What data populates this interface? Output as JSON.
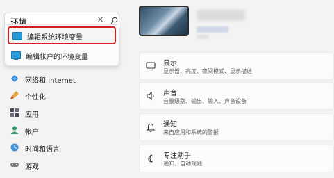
{
  "search": {
    "value": "环境",
    "clear_glyph": "×"
  },
  "results": [
    {
      "label": "编辑系统环境变量",
      "icon": "control-panel-icon"
    },
    {
      "label": "编辑帐户的环境变量",
      "icon": "control-panel-icon"
    }
  ],
  "nav": [
    {
      "label": "网络和 Internet",
      "icon": "network-icon"
    },
    {
      "label": "个性化",
      "icon": "brush-icon"
    },
    {
      "label": "应用",
      "icon": "apps-icon"
    },
    {
      "label": "帐户",
      "icon": "person-icon"
    },
    {
      "label": "时间和语言",
      "icon": "globe-clock-icon"
    },
    {
      "label": "游戏",
      "icon": "gamepad-icon"
    }
  ],
  "cards": [
    {
      "title": "显示",
      "subtitle": "显示器、亮度、夜间模式、显示描述",
      "icon": "monitor-icon"
    },
    {
      "title": "声音",
      "subtitle": "音量级别、输出、输入、声音设备",
      "icon": "speaker-icon"
    },
    {
      "title": "通知",
      "subtitle": "来自应用和系统的警报",
      "icon": "bell-icon"
    },
    {
      "title": "专注助手",
      "subtitle": "通知、自动规则",
      "icon": "moon-icon"
    }
  ],
  "colors": {
    "accent": "#0067c0",
    "highlight_border": "#d21f1f"
  }
}
